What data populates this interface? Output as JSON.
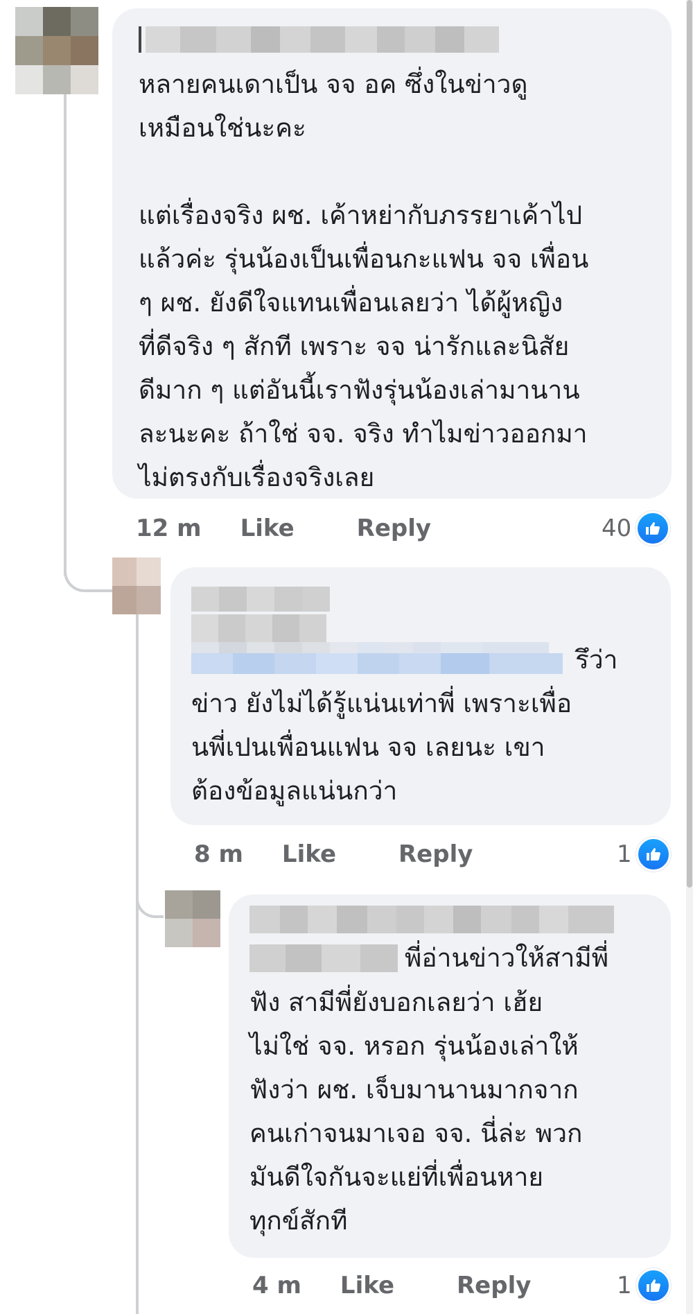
{
  "comments": [
    {
      "text": "หลายคนเดาเป็น จจ อค ซึ่งในข่าวดู\nเหมือนใช่นะคะ\n\nแต่เรื่องจริง ผช. เค้าหย่ากับภรรยาเค้าไป\nแล้วค่ะ รุ่นน้องเป็นเพื่อนกะแฟน จจ เพื่อน\nๆ ผช. ยังดีใจแทนเพื่อนเลยว่า ได้ผู้หญิง\nที่ดีจริง ๆ สักที เพราะ จจ น่ารักและนิสัย\nดีมาก ๆ แต่อันนี้เราฟังรุ่นน้องเล่ามานาน\nละนะคะ ถ้าใช่ จจ. จริง ทำไมข่าวออกมา\nไม่ตรงกับเรื่องจริงเลย",
      "time": "12 m",
      "like_label": "Like",
      "reply_label": "Reply",
      "reaction_count": "40"
    },
    {
      "text_after_name": "รึว่า",
      "text": "ข่าว ยังไม่ได้รู้แน่นเท่าพี่ เพราะเพื่อ\nนพี่เปนเพื่อนแฟน จจ เลยนะ เขา\nต้องข้อมูลแน่นกว่า",
      "time": "8 m",
      "like_label": "Like",
      "reply_label": "Reply",
      "reaction_count": "1"
    },
    {
      "text_after_name": "พี่อ่านข่าวให้สามีพี่",
      "text": "ฟัง สามีพี่ยังบอกเลยว่า เฮ้ย\nไม่ใช่ จจ. หรอก รุ่นน้องเล่าให้\nฟังว่า ผช. เจ็บมานานมากจาก\nคนเก่าจนมาเจอ จจ. นี่ล่ะ พวก\nมันดีใจกันจะแย่ที่เพื่อนหาย\nทุกข์สักที",
      "time": "4 m",
      "like_label": "Like",
      "reply_label": "Reply",
      "reaction_count": "1"
    }
  ],
  "icons": {
    "reaction": "like-thumb-icon"
  },
  "colors": {
    "bubble": "#f0f2f5",
    "meta_text": "#65676b",
    "like_blue": "#1877f2"
  }
}
